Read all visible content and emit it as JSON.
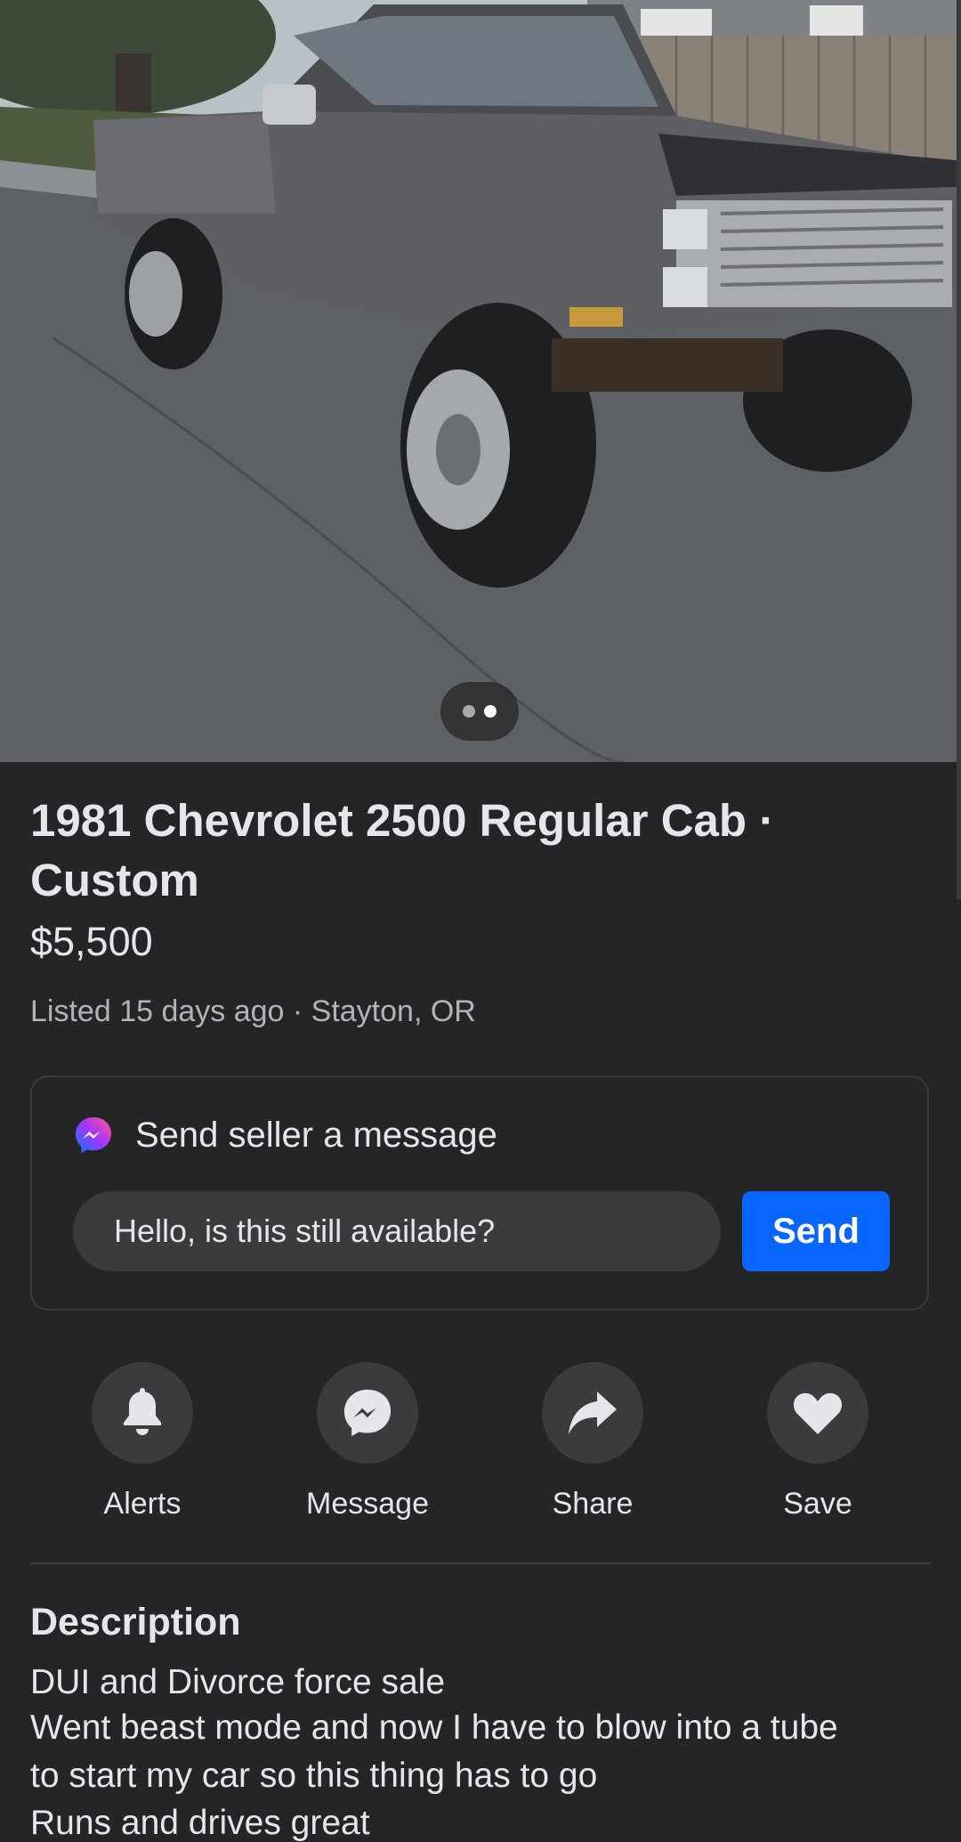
{
  "listing": {
    "title": "1981 Chevrolet 2500 Regular Cab · Custom",
    "price": "$5,500",
    "meta": "Listed 15 days ago · Stayton, OR",
    "photo": {
      "current_index": 2,
      "total": 2
    }
  },
  "message_box": {
    "heading": "Send seller a message",
    "input_value": "Hello, is this still available?",
    "send_label": "Send"
  },
  "actions": [
    {
      "label": "Alerts",
      "icon": "bell-icon"
    },
    {
      "label": "Message",
      "icon": "messenger-icon"
    },
    {
      "label": "Share",
      "icon": "share-arrow-icon"
    },
    {
      "label": "Save",
      "icon": "heart-icon"
    }
  ],
  "description": {
    "heading": "Description",
    "lines": [
      "DUI and Divorce force sale",
      "Went beast mode and now I have to blow into a tube",
      "to start my car so this thing has to go",
      "Runs and drives great"
    ]
  },
  "colors": {
    "background": "#242526",
    "surface": "#3a3b3c",
    "accent": "#0866ff",
    "text_primary": "#e4e6eb",
    "text_secondary": "#b0b3b8"
  }
}
